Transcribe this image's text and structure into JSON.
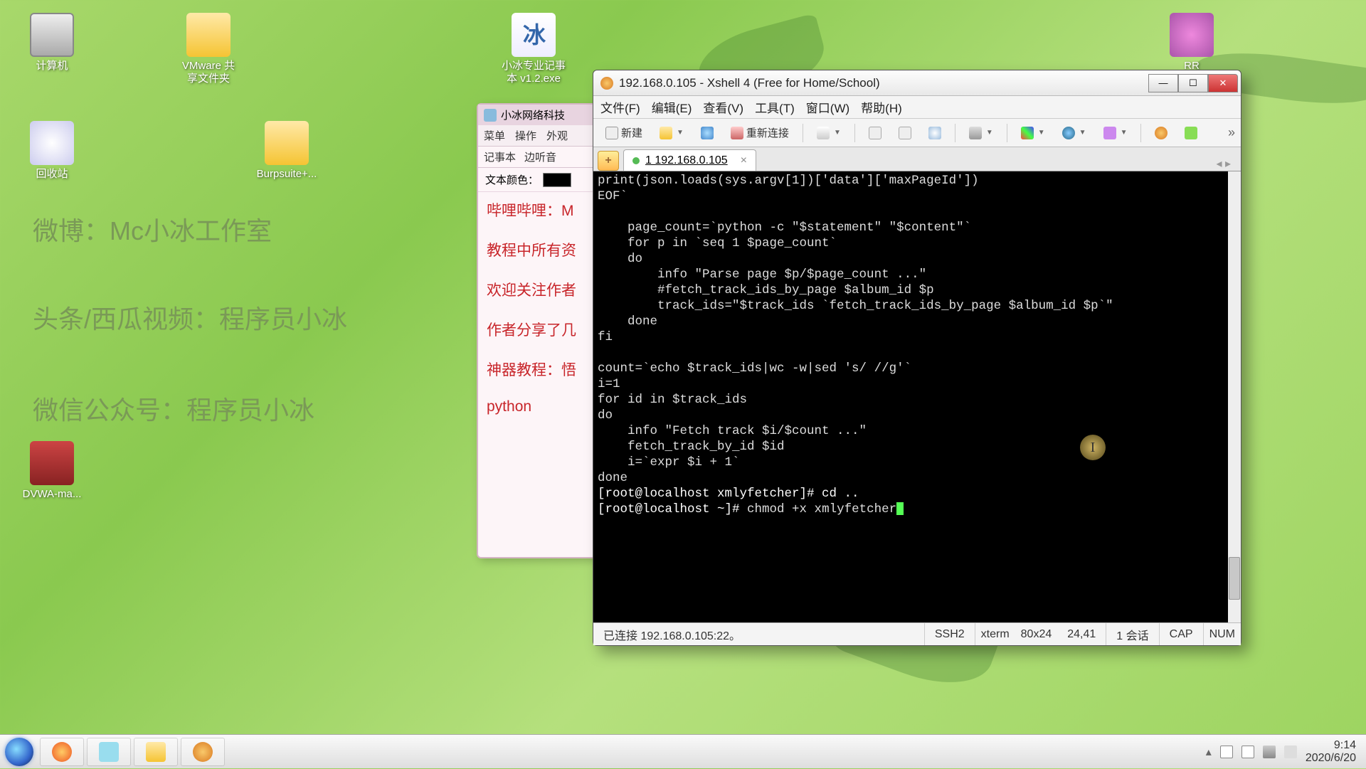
{
  "desktop": {
    "icons": [
      {
        "name": "computer",
        "label": "计算机"
      },
      {
        "name": "vmware-share",
        "label": "VMware 共\n享文件夹"
      },
      {
        "name": "notes-exe",
        "label": "小冰专业记事\n本 v1.2.exe"
      },
      {
        "name": "rr-clock",
        "label": "RR"
      },
      {
        "name": "recycle",
        "label": "回收站"
      },
      {
        "name": "burp",
        "label": "Burpsuite+..."
      },
      {
        "name": "dvwa",
        "label": "DVWA-ma..."
      }
    ],
    "watermarks": [
      "微博：Mc小冰工作室",
      "头条/西瓜视频：程序员小冰",
      "微信公众号：程序员小冰"
    ]
  },
  "notepad": {
    "title": "小冰网络科技",
    "menu": [
      "菜单",
      "操作",
      "外观"
    ],
    "tabs": [
      "记事本",
      "边听音"
    ],
    "color_label": "文本颜色：",
    "lines": [
      "哔哩哔哩：M",
      "教程中所有资",
      "欢迎关注作者",
      "作者分享了几",
      "神器教程：悟",
      "python"
    ]
  },
  "xshell": {
    "title": "192.168.0.105 - Xshell 4 (Free for Home/School)",
    "menu": [
      "文件(F)",
      "编辑(E)",
      "查看(V)",
      "工具(T)",
      "窗口(W)",
      "帮助(H)"
    ],
    "toolbar": {
      "new": "新建",
      "reconnect": "重新连接"
    },
    "tab": {
      "label": "1 192.168.0.105"
    },
    "terminal_lines": [
      "print(json.loads(sys.argv[1])['data']['maxPageId'])",
      "EOF`",
      "",
      "    page_count=`python -c \"$statement\" \"$content\"`",
      "    for p in `seq 1 $page_count`",
      "    do",
      "        info \"Parse page $p/$page_count ...\"",
      "        #fetch_track_ids_by_page $album_id $p",
      "        track_ids=\"$track_ids `fetch_track_ids_by_page $album_id $p`\"",
      "    done",
      "fi",
      "",
      "count=`echo $track_ids|wc -w|sed 's/ //g'`",
      "i=1",
      "for id in $track_ids",
      "do",
      "    info \"Fetch track $i/$count ...\"",
      "    fetch_track_by_id $id",
      "    i=`expr $i + 1`",
      "done",
      ""
    ],
    "prompt1": "[root@localhost xmlyfetcher]# cd ..",
    "prompt2_pre": "[root@localhost ~]# ",
    "prompt2_cmd": "chmod +x xmlyfetcher",
    "status": {
      "conn": "已连接 192.168.0.105:22。",
      "proto": "SSH2",
      "term": "xterm",
      "size": "80x24",
      "pos": "24,41",
      "sess": "1 会话",
      "cap": "CAP",
      "num": "NUM"
    }
  },
  "taskbar": {
    "time": "9:14",
    "date": "2020/6/20"
  }
}
